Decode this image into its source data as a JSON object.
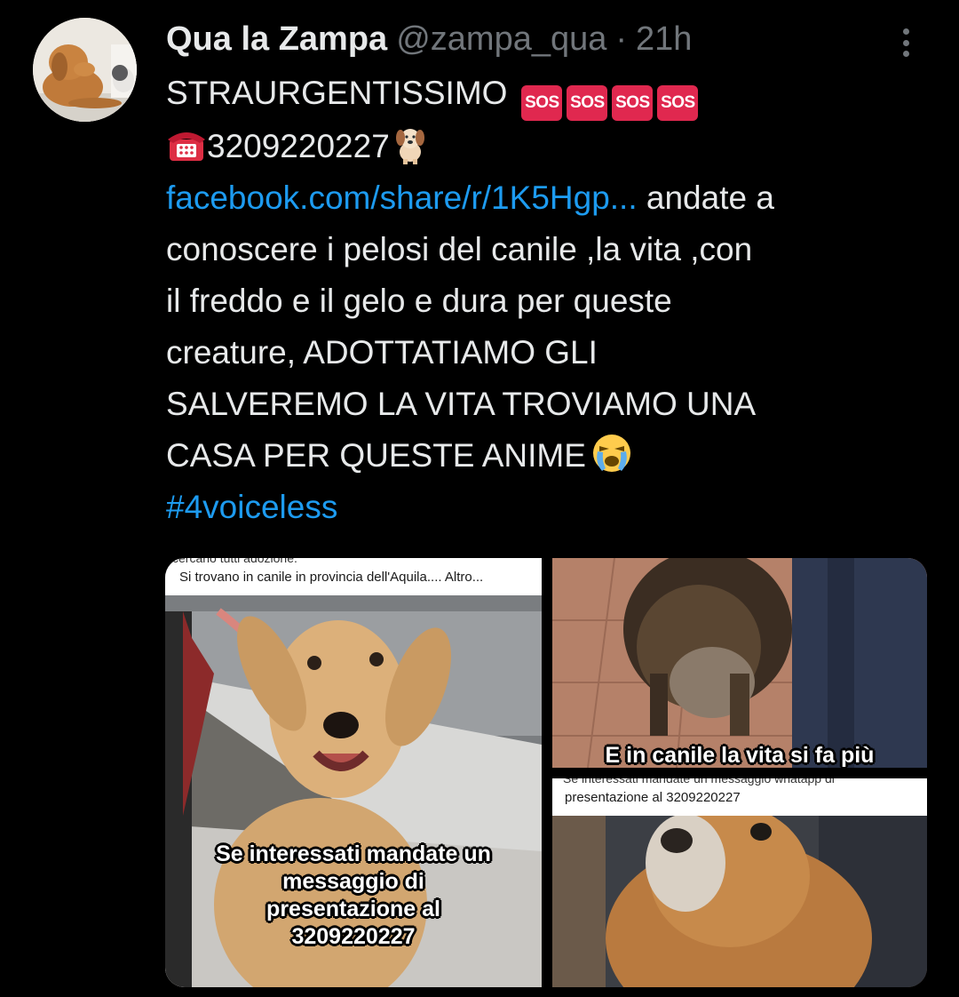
{
  "author": {
    "display_name": "Qua la Zampa",
    "handle": "@zampa_qua",
    "separator": "·",
    "time": "21h",
    "avatar_icon": "dog-with-cat-avatar"
  },
  "tweet": {
    "line1_text": "STRAURGENTISSIMO",
    "sos_label": "SOS",
    "sos_count": 4,
    "phone": "3209220227",
    "link": "facebook.com/share/r/1K5Hgp...",
    "line3_rest": " andate a",
    "body_lines": [
      "conoscere i  pelosi del canile ,la vita ,con",
      "il freddo e il gelo e dura per queste",
      "creature, ADOTTATIAMO GLI",
      "SALVEREMO LA VITA TROVIAMO UNA",
      "CASA PER QUESTE ANIME"
    ],
    "hashtag": "#4voiceless"
  },
  "media": {
    "image1": {
      "top_partial": "cercano tutti adozione.",
      "caption": "Si trovano in canile in provincia dell'Aquila.... Altro...",
      "overlay_lines": [
        "Se interessati mandate un",
        "messaggio di",
        "presentazione al",
        "3209220227"
      ]
    },
    "image2": {
      "overlay": "E in canile la vita si fa più"
    },
    "image3": {
      "top_partial": "Se interessati mandate un messaggio whatapp di",
      "caption": "presentazione al 3209220227"
    }
  },
  "colors": {
    "background": "#000000",
    "text": "#e7e9ea",
    "secondary": "#71767b",
    "link": "#1d9bf0",
    "sos": "#e0284f"
  }
}
